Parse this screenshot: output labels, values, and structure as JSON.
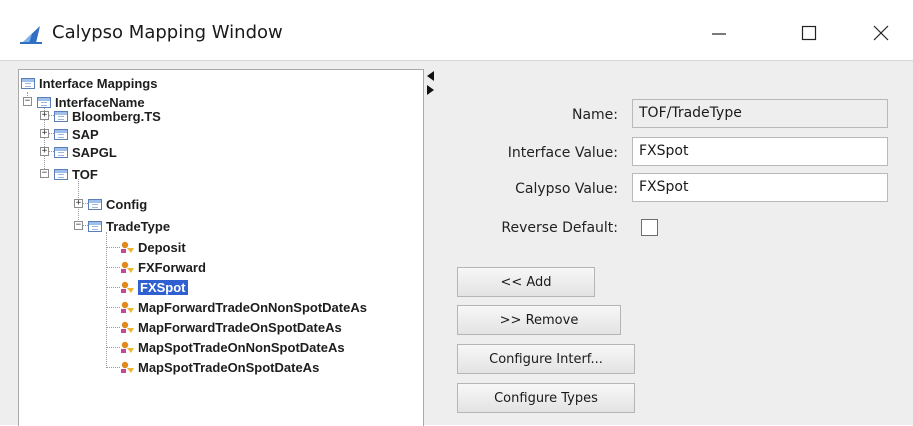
{
  "window": {
    "title": "Calypso Mapping Window",
    "minimize_glyph": "minimize-icon",
    "maximize_glyph": "maximize-icon",
    "close_glyph": "close-icon"
  },
  "tree": {
    "root": "Interface Mappings",
    "interface_name": "InterfaceName",
    "bloomberg": "Bloomberg.TS",
    "sap": "SAP",
    "sapgl": "SAPGL",
    "tof": "TOF",
    "config": "Config",
    "trade_type": "TradeType",
    "leaves": [
      "Deposit",
      "FXForward",
      "FXSpot",
      "MapForwardTradeOnNonSpotDateAs",
      "MapForwardTradeOnSpotDateAs",
      "MapSpotTradeOnNonSpotDateAs",
      "MapSpotTradeOnSpotDateAs"
    ],
    "selected": "FXSpot"
  },
  "form": {
    "name_label": "Name:",
    "name_value": "TOF/TradeType",
    "interface_label": "Interface Value:",
    "interface_value": "FXSpot",
    "calypso_label": "Calypso Value:",
    "calypso_value": "FXSpot",
    "reverse_label": "Reverse Default:",
    "reverse_checked": false
  },
  "buttons": {
    "add": "<< Add",
    "remove": ">> Remove",
    "configure_interf": "Configure Interf...",
    "configure_types": "Configure Types"
  },
  "colors": {
    "selection": "#2f5fd0",
    "icon_blue": "#5a7fb8",
    "leaf_orange": "#e08a1e"
  }
}
